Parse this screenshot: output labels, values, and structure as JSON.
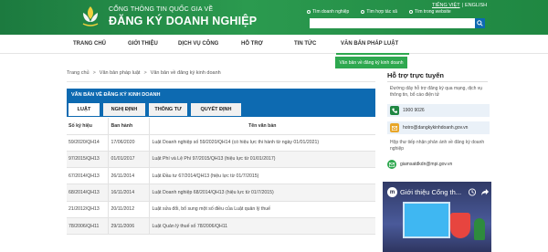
{
  "header": {
    "brand_line1": "CỔNG THÔNG TIN QUỐC GIA VỀ",
    "brand_line2": "ĐĂNG KÝ DOANH NGHIỆP",
    "lang_vi": "TIẾNG VIỆT",
    "lang_sep": "|",
    "lang_en": "ENGLISH",
    "search_placeholder": "",
    "radio_options": [
      "Tìm doanh nghiệp",
      "Tìm hợp tác xã",
      "Tìm trong website"
    ],
    "colors": {
      "header_green": "#1f8742",
      "search_button": "#0d6ab1"
    }
  },
  "nav": {
    "items": [
      "TRANG CHỦ",
      "GIỚI THIỆU",
      "DỊCH VỤ CÔNG",
      "HỖ TRỢ",
      "TIN TỨC",
      "VĂN BẢN PHÁP LUẬT"
    ],
    "active": "VĂN BẢN PHÁP LUẬT",
    "dropdown_item": "Văn bản về đăng ký kinh doanh"
  },
  "breadcrumb": {
    "items": [
      "Trang chủ",
      "Văn bản pháp luật",
      "Văn bản về đăng ký kinh doanh"
    ],
    "separator": ">"
  },
  "documents": {
    "panel_title": "VĂN BẢN VỀ ĐĂNG KÝ KINH DOANH",
    "tabs": [
      "LUẬT",
      "NGHỊ ĐỊNH",
      "THÔNG TƯ",
      "QUYẾT ĐỊNH"
    ],
    "active_tab": "LUẬT",
    "columns": [
      "Số ký hiệu",
      "Ban hành",
      "Tên văn bản"
    ],
    "rows": [
      [
        "59/2020/QH14",
        "17/06/2020",
        "Luật Doanh nghiệp số 59/2020/QH14 (có hiệu lực thi hành từ ngày 01/01/2021)"
      ],
      [
        "97/2015/QH13",
        "01/01/2017",
        "Luật Phí và Lệ Phí 97/2015/QH13 (hiệu lực từ 01/01/2017)"
      ],
      [
        "67/2014/QH13",
        "26/11/2014",
        "Luật Đầu tư 67/2014/QH13 (hiệu lực từ 01/7/2015)"
      ],
      [
        "68/2014/QH13",
        "16/11/2014",
        "Luật Doanh nghiệp 68/2014/QH13 (hiệu lực từ 01/7/2015)"
      ],
      [
        "21/2012/QH13",
        "20/11/2012",
        "Luật sửa đổi, bổ sung một số điều của Luật quản lý thuế"
      ],
      [
        "78/2006/QH11",
        "29/11/2006",
        "Luật Quản lý thuế số 78/2006/QH11"
      ]
    ],
    "colors": {
      "panel_blue": "#0d6ab1"
    }
  },
  "support": {
    "title": "Hỗ trợ trực tuyến",
    "desc1": "Đường dây hỗ trợ đăng ký qua mạng, dịch vụ thông tin, bổ cáo điện tử",
    "phone": "1900 9026",
    "email": "hotro@dangkykinhdoanh.gov.vn",
    "desc2": "Hộp thư tiếp nhận phản ánh về đăng ký doanh nghiệp",
    "email2": "giamsatdkdn@mpi.gov.vn"
  },
  "video": {
    "channel_initial": "m",
    "title": "Giới thiệu Cổng th..."
  }
}
